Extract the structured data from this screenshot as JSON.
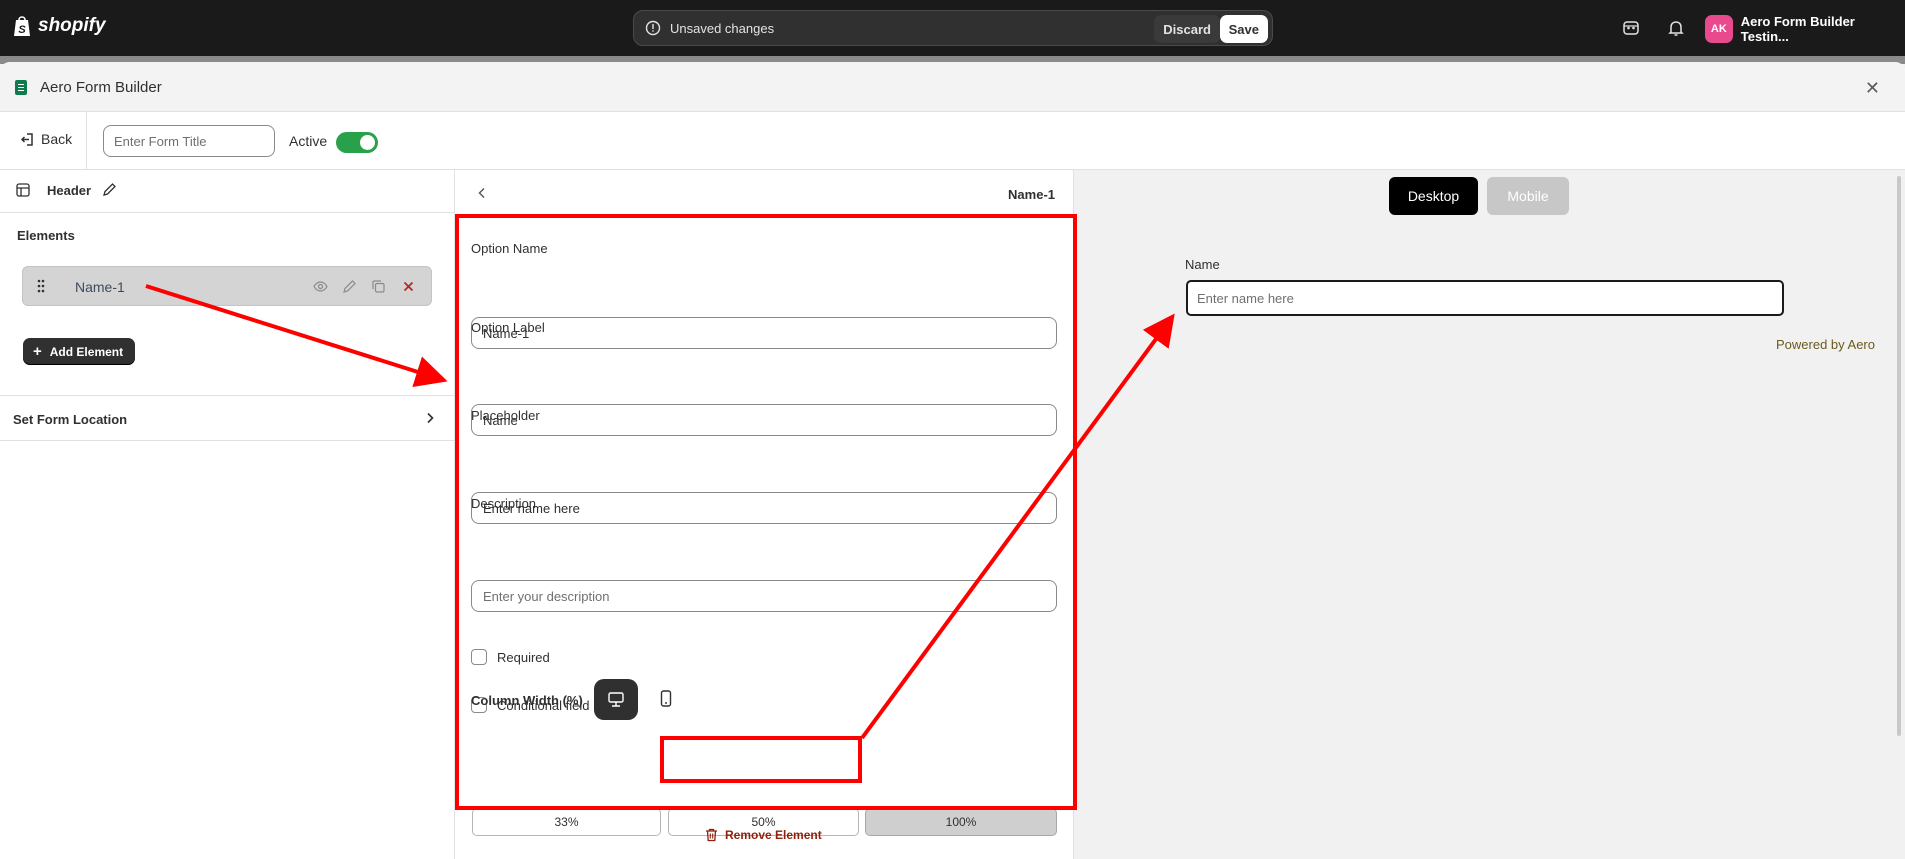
{
  "topbar": {
    "logo_text": "shopify",
    "unsaved_text": "Unsaved changes",
    "discard_label": "Discard",
    "save_label": "Save",
    "avatar_initials": "AK",
    "store_name": "Aero Form Builder Testin..."
  },
  "modal": {
    "title": "Aero Form Builder",
    "back_label": "Back",
    "form_title_placeholder": "Enter Form Title",
    "active_label": "Active",
    "active_on": true
  },
  "left_panel": {
    "header_label": "Header",
    "elements_title": "Elements",
    "element_items": [
      {
        "name": "Name-1"
      }
    ],
    "add_element_label": "Add Element",
    "set_location_label": "Set Form Location"
  },
  "editor": {
    "element_name": "Name-1",
    "option_name_label": "Option Name",
    "option_name_value": "Name-1",
    "option_label_label": "Option Label",
    "option_label_value": "Name",
    "placeholder_label": "Placeholder",
    "placeholder_value": "Enter name here",
    "description_label": "Description",
    "description_placeholder": "Enter your description",
    "required_label": "Required",
    "conditional_label": "Conditional field",
    "help_glyph": "?",
    "column_width_label": "Column Width (%)",
    "widths": [
      {
        "label": "33%",
        "selected": false
      },
      {
        "label": "50%",
        "selected": false
      },
      {
        "label": "100%",
        "selected": true
      }
    ],
    "remove_label": "Remove Element"
  },
  "preview": {
    "desktop_label": "Desktop",
    "mobile_label": "Mobile",
    "field_label": "Name",
    "field_placeholder": "Enter name here",
    "powered_by": "Powered by Aero"
  },
  "colors": {
    "topbar_bg": "#1a1a1a",
    "toggle_on": "#29a14a",
    "annotation_red": "#ff0000",
    "remove_red": "#8e1f0b"
  }
}
